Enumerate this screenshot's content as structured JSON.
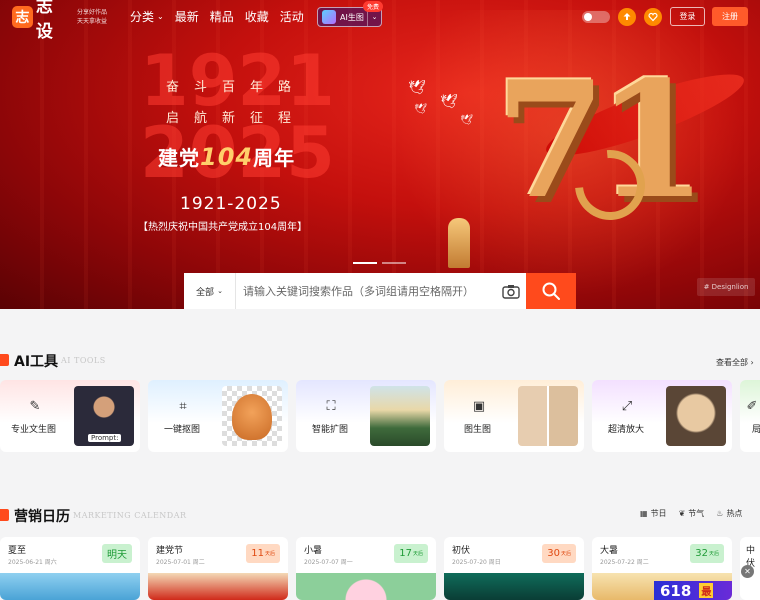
{
  "brand": {
    "logo_mark": "志",
    "name": "志设",
    "slogan_line1": "分享好作品",
    "slogan_line2": "天天拿收益",
    "colors": {
      "accent": "#ff4a1c",
      "orange": "#ff8a00",
      "hero_red": "#c4100d"
    }
  },
  "nav": {
    "items": [
      {
        "label": "分类",
        "has_dropdown": true
      },
      {
        "label": "最新"
      },
      {
        "label": "精品"
      },
      {
        "label": "收藏"
      },
      {
        "label": "活动"
      }
    ],
    "ai_button": {
      "label": "AI生图",
      "badge": "免费"
    },
    "login": "登录",
    "register": "注册"
  },
  "hero": {
    "big_year_top": "1921",
    "big_year_bottom": "2025",
    "line1": "奋斗百年路",
    "line2": "启航新征程",
    "title_pre": "建党",
    "title_num": "104",
    "title_post": "周年",
    "years": "1921-2025",
    "celebrate": "【热烈庆祝中国共产党成立104周年】",
    "big_number": "71",
    "designer": "# Designlion"
  },
  "search": {
    "scope": "全部",
    "placeholder": "请输入关键词搜索作品（多词组请用空格隔开）",
    "value": ""
  },
  "ai_tools": {
    "title": "AI工具",
    "subtitle": "AI TOOLS",
    "view_all": "查看全部",
    "items": [
      {
        "label": "专业文生图",
        "icon": "brush-icon",
        "thumb_caption": "Prompt:"
      },
      {
        "label": "一键抠图",
        "icon": "cutout-icon"
      },
      {
        "label": "智能扩图",
        "icon": "expand-icon"
      },
      {
        "label": "图生图",
        "icon": "image-icon"
      },
      {
        "label": "超清放大",
        "icon": "enlarge-icon"
      },
      {
        "label": "局",
        "icon": "edit-icon"
      }
    ]
  },
  "calendar": {
    "title": "营销日历",
    "subtitle": "MARKETING CALENDAR",
    "filters": [
      {
        "label": "节日",
        "icon": "calendar-icon"
      },
      {
        "label": "节气",
        "icon": "leaf-icon"
      },
      {
        "label": "热点",
        "icon": "flame-icon"
      }
    ],
    "days": [
      {
        "name": "夏至",
        "date": "2025-06-21 周六",
        "badge": "明天",
        "badge_unit": "",
        "style": "green"
      },
      {
        "name": "建党节",
        "date": "2025-07-01 周二",
        "badge": "11",
        "badge_unit": "天后",
        "style": "orange"
      },
      {
        "name": "小暑",
        "date": "2025-07-07 周一",
        "badge": "17",
        "badge_unit": "天后",
        "style": "green"
      },
      {
        "name": "初伏",
        "date": "2025-07-20 周日",
        "badge": "30",
        "badge_unit": "天后",
        "style": "orange"
      },
      {
        "name": "大暑",
        "date": "2025-07-22 周二",
        "badge": "32",
        "badge_unit": "天后",
        "style": "green"
      },
      {
        "name": "中伏",
        "date": "",
        "badge": "",
        "badge_unit": "",
        "style": "green"
      }
    ],
    "promo_text_1": "618",
    "promo_text_2": "最"
  }
}
